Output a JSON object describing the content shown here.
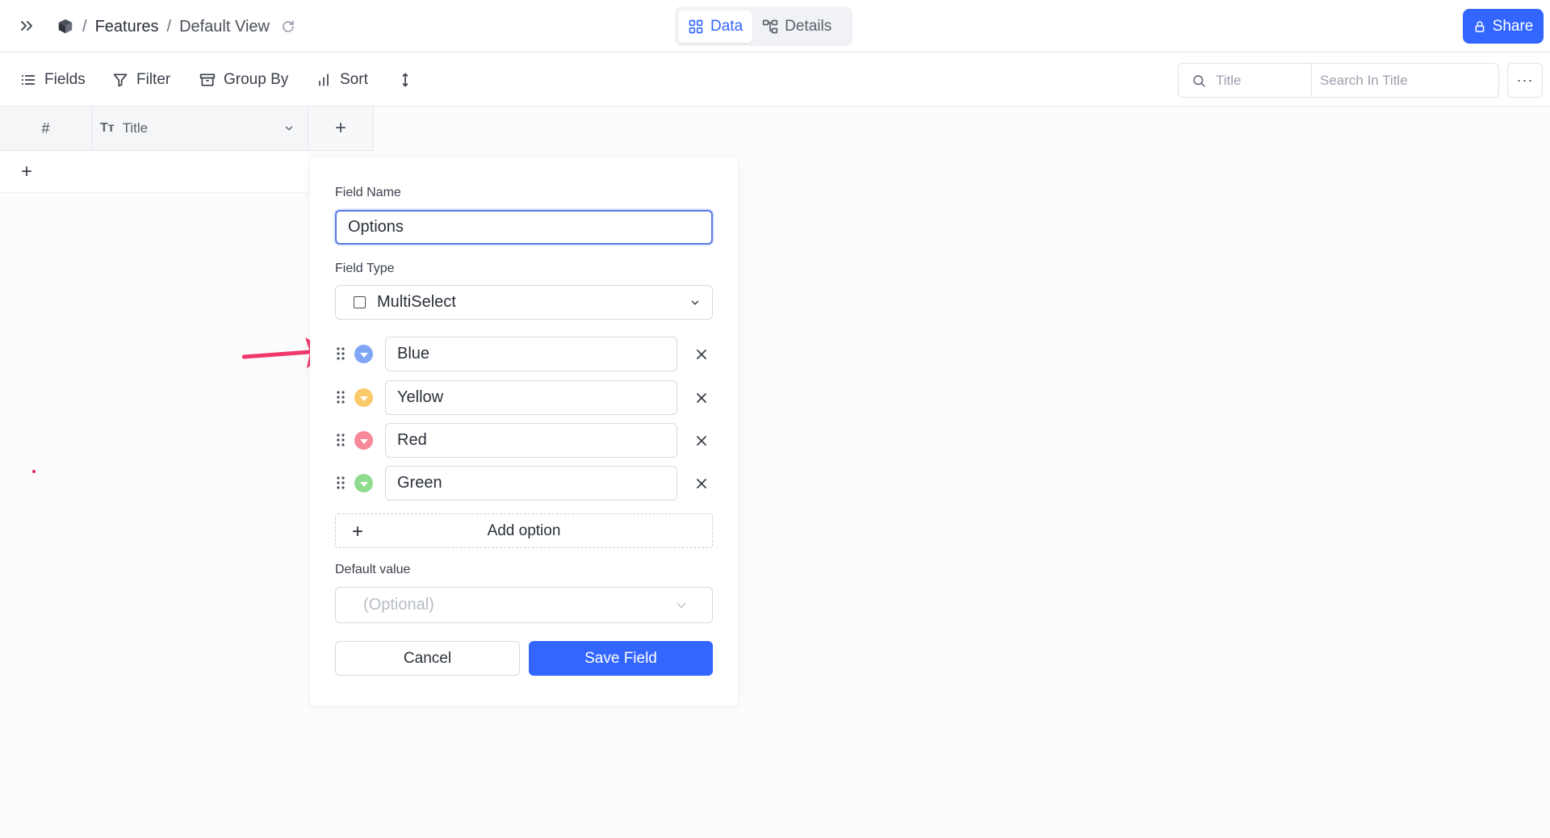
{
  "breadcrumb": {
    "separator": "/",
    "base": "Features",
    "view": "Default View"
  },
  "view_tabs": [
    {
      "label": "Data",
      "icon": "grid-icon",
      "active": true
    },
    {
      "label": "Details",
      "icon": "details-icon",
      "active": false
    }
  ],
  "share": {
    "label": "Share",
    "icon": "lock-icon",
    "color": "#3366ff"
  },
  "toolbar": {
    "fields": "Fields",
    "filter": "Filter",
    "group_by": "Group By",
    "sort": "Sort"
  },
  "search": {
    "field_label": "Title",
    "placeholder": "Search In Title"
  },
  "more": {
    "label": "···"
  },
  "grid": {
    "row_number_header": "#",
    "title_type_icon": "Tт",
    "title_header": "Title",
    "add_column": "+",
    "add_row": "+"
  },
  "form": {
    "field_name_label": "Field Name",
    "field_name_value": "Options",
    "field_type_label": "Field Type",
    "field_type_value": "MultiSelect",
    "options": [
      {
        "label": "Blue",
        "color": "#7ea6f5"
      },
      {
        "label": "Yellow",
        "color": "#f9c96a"
      },
      {
        "label": "Red",
        "color": "#f7889a"
      },
      {
        "label": "Green",
        "color": "#8fdc8f"
      }
    ],
    "add_option": "Add option",
    "add_option_icon": "+",
    "default_value_label": "Default value",
    "default_value_placeholder": "(Optional)",
    "cancel": "Cancel",
    "save": "Save Field"
  },
  "colors": {
    "accent": "#3366ff",
    "annotation_arrow": "#f0386b"
  }
}
